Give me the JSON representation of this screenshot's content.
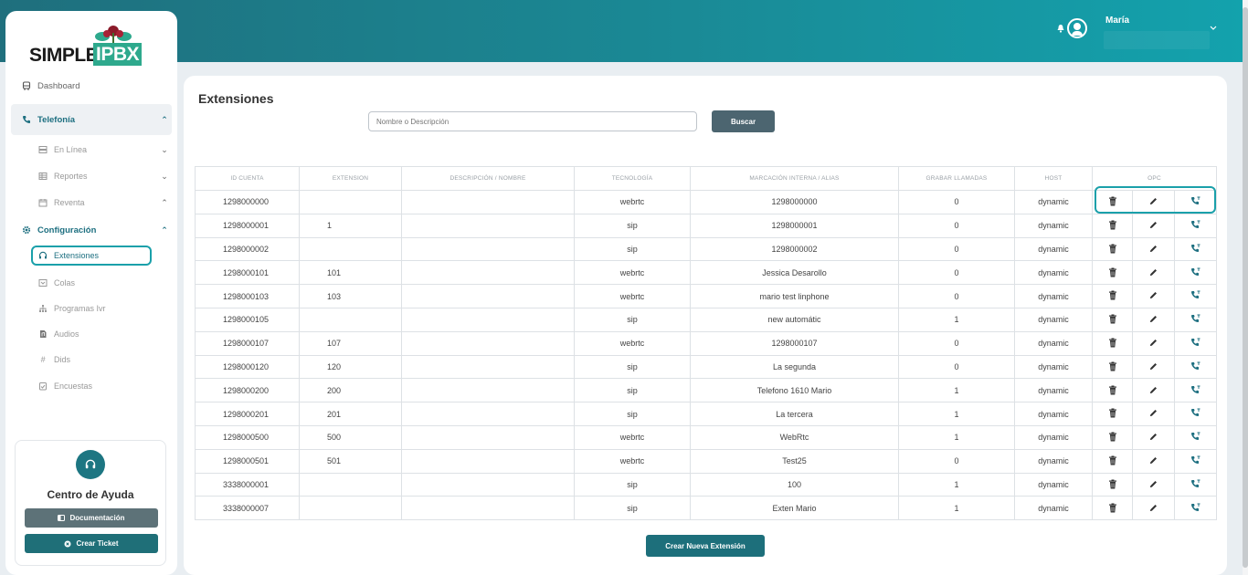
{
  "brand": {
    "simple": "SIMPLE",
    "ipbx": "IPBX"
  },
  "header": {
    "user_name": "María"
  },
  "sidebar": {
    "dashboard": "Dashboard",
    "telefonia": "Telefonía",
    "en_linea": "En Línea",
    "reportes": "Reportes",
    "reventa": "Reventa",
    "configuracion": "Configuración",
    "extensiones": "Extensiones",
    "colas": "Colas",
    "programas": "Programas Ivr",
    "audios": "Audios",
    "dids": "Dids",
    "encuestas": "Encuestas"
  },
  "help": {
    "title": "Centro de Ayuda",
    "doc": "Documentación",
    "ticket": "Crear Ticket"
  },
  "main": {
    "title": "Extensiones",
    "search_placeholder": "Nombre o Descripción",
    "search_button": "Buscar",
    "create_button": "Crear Nueva Extensión"
  },
  "table": {
    "headers": [
      "ID CUENTA",
      "EXTENSION",
      "DESCRIPCIÓN / NOMBRE",
      "TECNOLOGÍA",
      "MARCACIÓN INTERNA / ALIAS",
      "GRABAR LLAMADAS",
      "HOST",
      "OPC"
    ],
    "rows": [
      {
        "id": "1298000000",
        "ext": "",
        "desc": "",
        "tech": "webrtc",
        "alias": "1298000000",
        "grabar": "0",
        "host": "dynamic"
      },
      {
        "id": "1298000001",
        "ext": "1",
        "desc": "",
        "tech": "sip",
        "alias": "1298000001",
        "grabar": "0",
        "host": "dynamic"
      },
      {
        "id": "1298000002",
        "ext": "",
        "desc": "",
        "tech": "sip",
        "alias": "1298000002",
        "grabar": "0",
        "host": "dynamic"
      },
      {
        "id": "1298000101",
        "ext": "101",
        "desc": "",
        "tech": "webrtc",
        "alias": "Jessica Desarollo",
        "grabar": "0",
        "host": "dynamic"
      },
      {
        "id": "1298000103",
        "ext": "103",
        "desc": "",
        "tech": "webrtc",
        "alias": "mario test linphone",
        "grabar": "0",
        "host": "dynamic"
      },
      {
        "id": "1298000105",
        "ext": "",
        "desc": "",
        "tech": "sip",
        "alias": "new automátic",
        "grabar": "1",
        "host": "dynamic"
      },
      {
        "id": "1298000107",
        "ext": "107",
        "desc": "",
        "tech": "webrtc",
        "alias": "1298000107",
        "grabar": "0",
        "host": "dynamic"
      },
      {
        "id": "1298000120",
        "ext": "120",
        "desc": "",
        "tech": "sip",
        "alias": "La segunda",
        "grabar": "0",
        "host": "dynamic"
      },
      {
        "id": "1298000200",
        "ext": "200",
        "desc": "",
        "tech": "sip",
        "alias": "Telefono 1610 Mario",
        "grabar": "1",
        "host": "dynamic"
      },
      {
        "id": "1298000201",
        "ext": "201",
        "desc": "",
        "tech": "sip",
        "alias": "La tercera",
        "grabar": "1",
        "host": "dynamic"
      },
      {
        "id": "1298000500",
        "ext": "500",
        "desc": "",
        "tech": "webrtc",
        "alias": "WebRtc",
        "grabar": "1",
        "host": "dynamic"
      },
      {
        "id": "1298000501",
        "ext": "501",
        "desc": "",
        "tech": "webrtc",
        "alias": "Test25",
        "grabar": "0",
        "host": "dynamic"
      },
      {
        "id": "3338000001",
        "ext": "",
        "desc": "",
        "tech": "sip",
        "alias": "100",
        "grabar": "1",
        "host": "dynamic"
      },
      {
        "id": "3338000007",
        "ext": "",
        "desc": "",
        "tech": "sip",
        "alias": "Exten Mario",
        "grabar": "1",
        "host": "dynamic"
      }
    ]
  },
  "icons": {
    "delete": "trash-icon",
    "edit": "pencil-icon",
    "call": "phone-icon"
  },
  "colors": {
    "accent": "#1d6f80",
    "highlight": "#1aa0aa",
    "header_start": "#1f6f7d",
    "header_end": "#13a2ad"
  }
}
